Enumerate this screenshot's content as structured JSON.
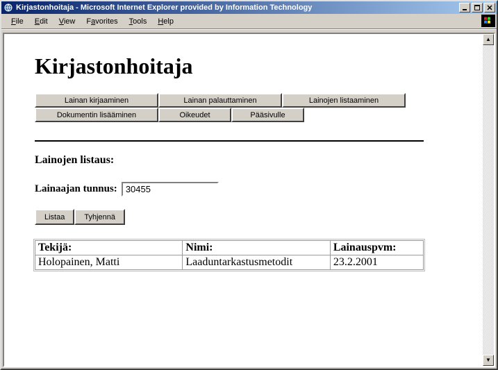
{
  "window": {
    "title": "Kirjastonhoitaja - Microsoft Internet Explorer provided by Information Technology"
  },
  "menu": {
    "file": "File",
    "edit": "Edit",
    "view": "View",
    "favorites": "Favorites",
    "tools": "Tools",
    "help": "Help"
  },
  "page": {
    "heading": "Kirjastonhoitaja",
    "nav": {
      "row1": [
        "Lainan kirjaaminen",
        "Lainan palauttaminen",
        "Lainojen listaaminen"
      ],
      "row2": [
        "Dokumentin lisääminen",
        "Oikeudet",
        "Pääsivulle"
      ]
    },
    "section_title": "Lainojen listaus:",
    "form": {
      "label": "Lainaajan tunnus:",
      "value": "30455",
      "list_btn": "Listaa",
      "clear_btn": "Tyhjennä"
    },
    "table": {
      "headers": [
        "Tekijä:",
        "Nimi:",
        "Lainauspvm:"
      ],
      "rows": [
        [
          "Holopainen, Matti",
          "Laaduntarkastusmetodit",
          "23.2.2001"
        ]
      ]
    }
  }
}
